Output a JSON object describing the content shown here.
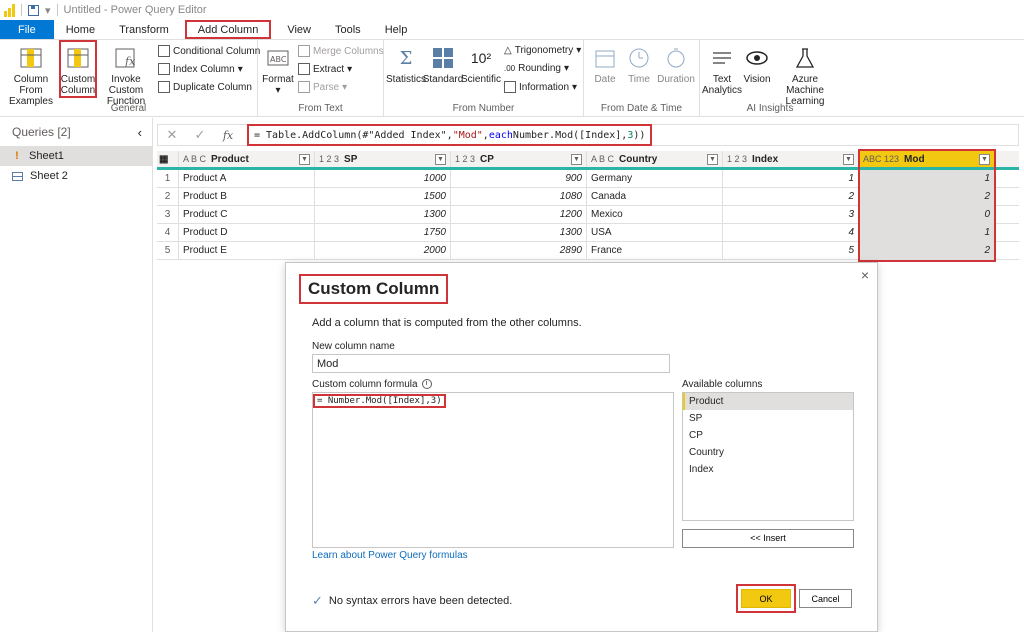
{
  "titlebar": {
    "title": "Untitled - Power Query Editor"
  },
  "tabs": [
    "File",
    "Home",
    "Transform",
    "Add Column",
    "View",
    "Tools",
    "Help"
  ],
  "ribbon": {
    "general": {
      "label": "General",
      "column_from_examples": "Column From Examples",
      "custom_column": "Custom Column",
      "invoke_custom_function": "Invoke Custom Function",
      "conditional_column": "Conditional Column",
      "index_column": "Index Column",
      "duplicate_column": "Duplicate Column"
    },
    "from_text": {
      "label": "From Text",
      "format": "Format",
      "merge_columns": "Merge Columns",
      "extract": "Extract",
      "parse": "Parse"
    },
    "from_number": {
      "label": "From Number",
      "statistics": "Statistics",
      "standard": "Standard",
      "scientific": "Scientific",
      "trigonometry": "Trigonometry",
      "rounding": "Rounding",
      "information": "Information"
    },
    "from_date_time": {
      "label": "From Date & Time",
      "date": "Date",
      "time": "Time",
      "duration": "Duration"
    },
    "ai_insights": {
      "label": "AI Insights",
      "text_analytics": "Text Analytics",
      "vision": "Vision",
      "azure_ml": "Azure Machine Learning"
    }
  },
  "queries": {
    "header": "Queries [2]",
    "items": [
      {
        "name": "Sheet1",
        "selected": true,
        "icon": "warning-icon"
      },
      {
        "name": "Sheet 2",
        "selected": false,
        "icon": "table-icon"
      }
    ]
  },
  "formula_bar": {
    "parts": [
      {
        "text": "= Table.AddColumn(#\"Added Index\", ",
        "cls": ""
      },
      {
        "text": "\"Mod\"",
        "cls": "str"
      },
      {
        "text": ", ",
        "cls": ""
      },
      {
        "text": "each",
        "cls": "kw"
      },
      {
        "text": " Number.Mod([Index],",
        "cls": ""
      },
      {
        "text": "3",
        "cls": "num"
      },
      {
        "text": "))",
        "cls": ""
      }
    ]
  },
  "grid": {
    "columns": [
      {
        "type": "A B C",
        "name": "Product"
      },
      {
        "type": "1 2 3",
        "name": "SP"
      },
      {
        "type": "1 2 3",
        "name": "CP"
      },
      {
        "type": "A B C",
        "name": "Country"
      },
      {
        "type": "1 2 3",
        "name": "Index"
      },
      {
        "type": "ABC 123",
        "name": "Mod"
      }
    ],
    "rows": [
      [
        "1",
        "Product A",
        "1000",
        "900",
        "Germany",
        "1",
        "1"
      ],
      [
        "2",
        "Product B",
        "1500",
        "1080",
        "Canada",
        "2",
        "2"
      ],
      [
        "3",
        "Product C",
        "1300",
        "1200",
        "Mexico",
        "3",
        "0"
      ],
      [
        "4",
        "Product D",
        "1750",
        "1300",
        "USA",
        "4",
        "1"
      ],
      [
        "5",
        "Product E",
        "2000",
        "2890",
        "France",
        "5",
        "2"
      ]
    ]
  },
  "dialog": {
    "title": "Custom Column",
    "description": "Add a column that is computed from the other columns.",
    "new_column_label": "New column name",
    "new_column_value": "Mod",
    "formula_label": "Custom column formula",
    "formula_value": "= Number.Mod([Index],3)",
    "available_label": "Available columns",
    "available_columns": [
      "Product",
      "SP",
      "CP",
      "Country",
      "Index"
    ],
    "insert_label": "<< Insert",
    "learn_link": "Learn about Power Query formulas",
    "status": "No syntax errors have been detected.",
    "ok_label": "OK",
    "cancel_label": "Cancel",
    "close_glyph": "×"
  }
}
